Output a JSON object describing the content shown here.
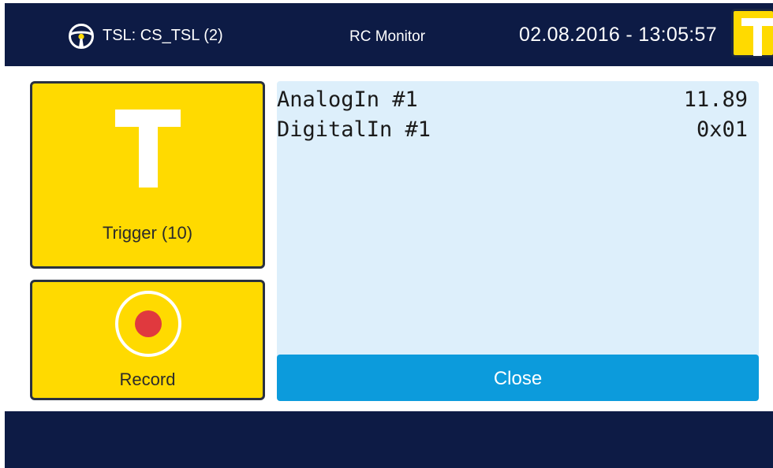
{
  "header": {
    "tsl_label": "TSL: CS_TSL (2)",
    "app_title": "RC Monitor",
    "datetime": "02.08.2016 - 13:05:57",
    "icons": [
      "steering-wheel-icon",
      "trigger-status-icon"
    ]
  },
  "tiles": {
    "trigger_label": "Trigger (10)",
    "record_label": "Record"
  },
  "monitor": {
    "rows": [
      {
        "name": "AnalogIn #1",
        "value": "11.89"
      },
      {
        "name": "DigitalIn #1",
        "value": "0x01"
      }
    ]
  },
  "close_label": "Close",
  "colors": {
    "bar": "#0d1b45",
    "tile": "#ffda00",
    "monitor_bg": "#ddeffb",
    "button": "#0c9bdc",
    "record_dot": "#e0393e"
  }
}
